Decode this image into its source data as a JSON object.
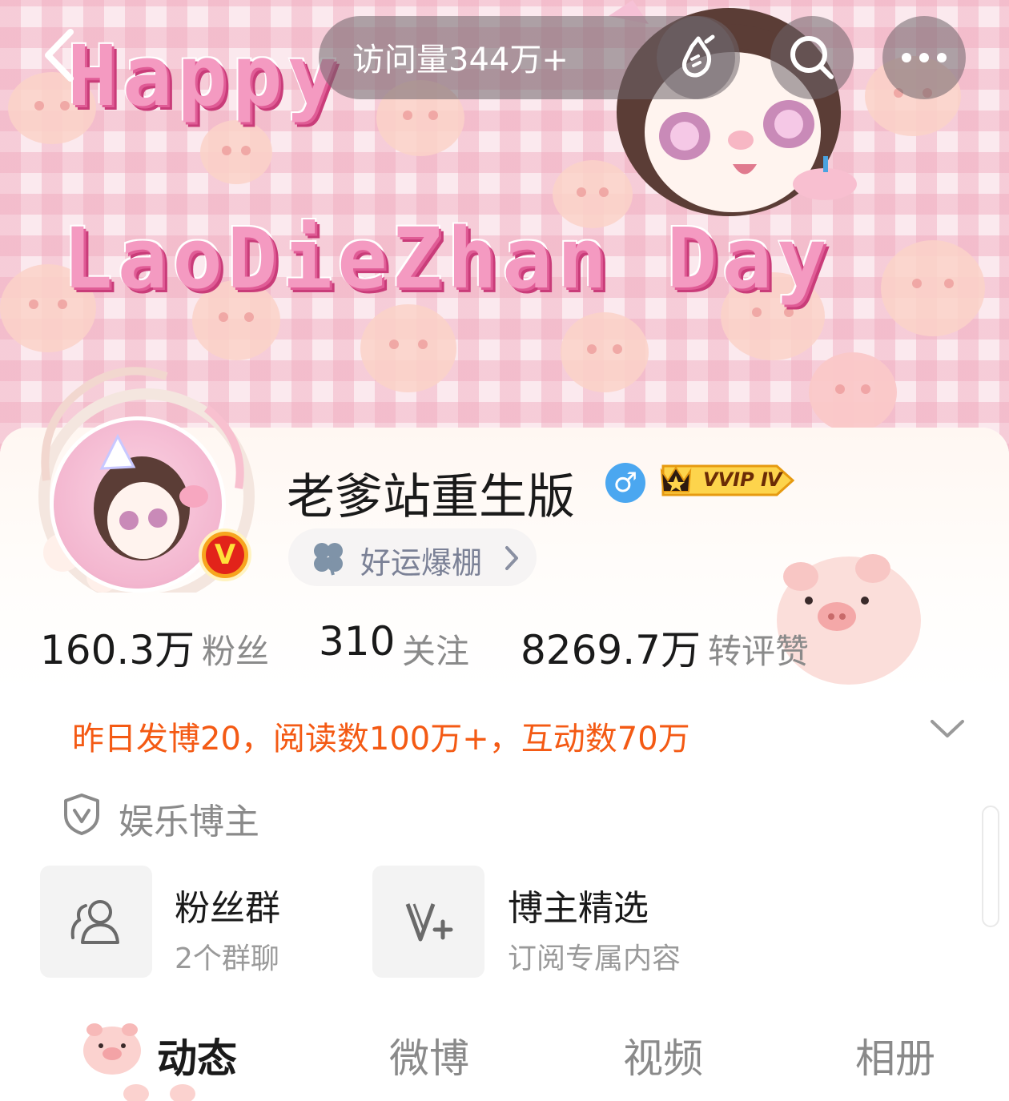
{
  "banner": {
    "line1": "Happy",
    "line2": "LaoDieZhan Day"
  },
  "topbar": {
    "visits": "访问量344万+",
    "back_icon": "chevron-left-icon",
    "bottle_icon": "drift-bottle-icon",
    "search_icon": "search-icon",
    "more_icon": "more-dots-icon"
  },
  "profile": {
    "name": "老爹站重生版",
    "gender_symbol": "♂",
    "vip_label": "VVIP Ⅳ",
    "verify_mark": "V",
    "luck": "好运爆棚"
  },
  "stats": [
    {
      "value": "160.3万",
      "label": "粉丝"
    },
    {
      "value": "310",
      "label": "关注"
    },
    {
      "value": "8269.7万",
      "label": "转评赞"
    }
  ],
  "summary": "昨日发博20，阅读数100万+，互动数70万",
  "category": "娱乐博主",
  "tiles": [
    {
      "title": "粉丝群",
      "subtitle": "2个群聊",
      "icon": "fan-group-icon"
    },
    {
      "title": "博主精选",
      "subtitle": "订阅专属内容",
      "icon": "v-plus-icon"
    }
  ],
  "tabs": [
    "动态",
    "微博",
    "视频",
    "相册"
  ],
  "colors": {
    "accent_orange": "#f45a14",
    "banner_pink": "#f49ac1",
    "verify_gold": "#f7a51e",
    "gender_blue": "#4ba7f0"
  }
}
